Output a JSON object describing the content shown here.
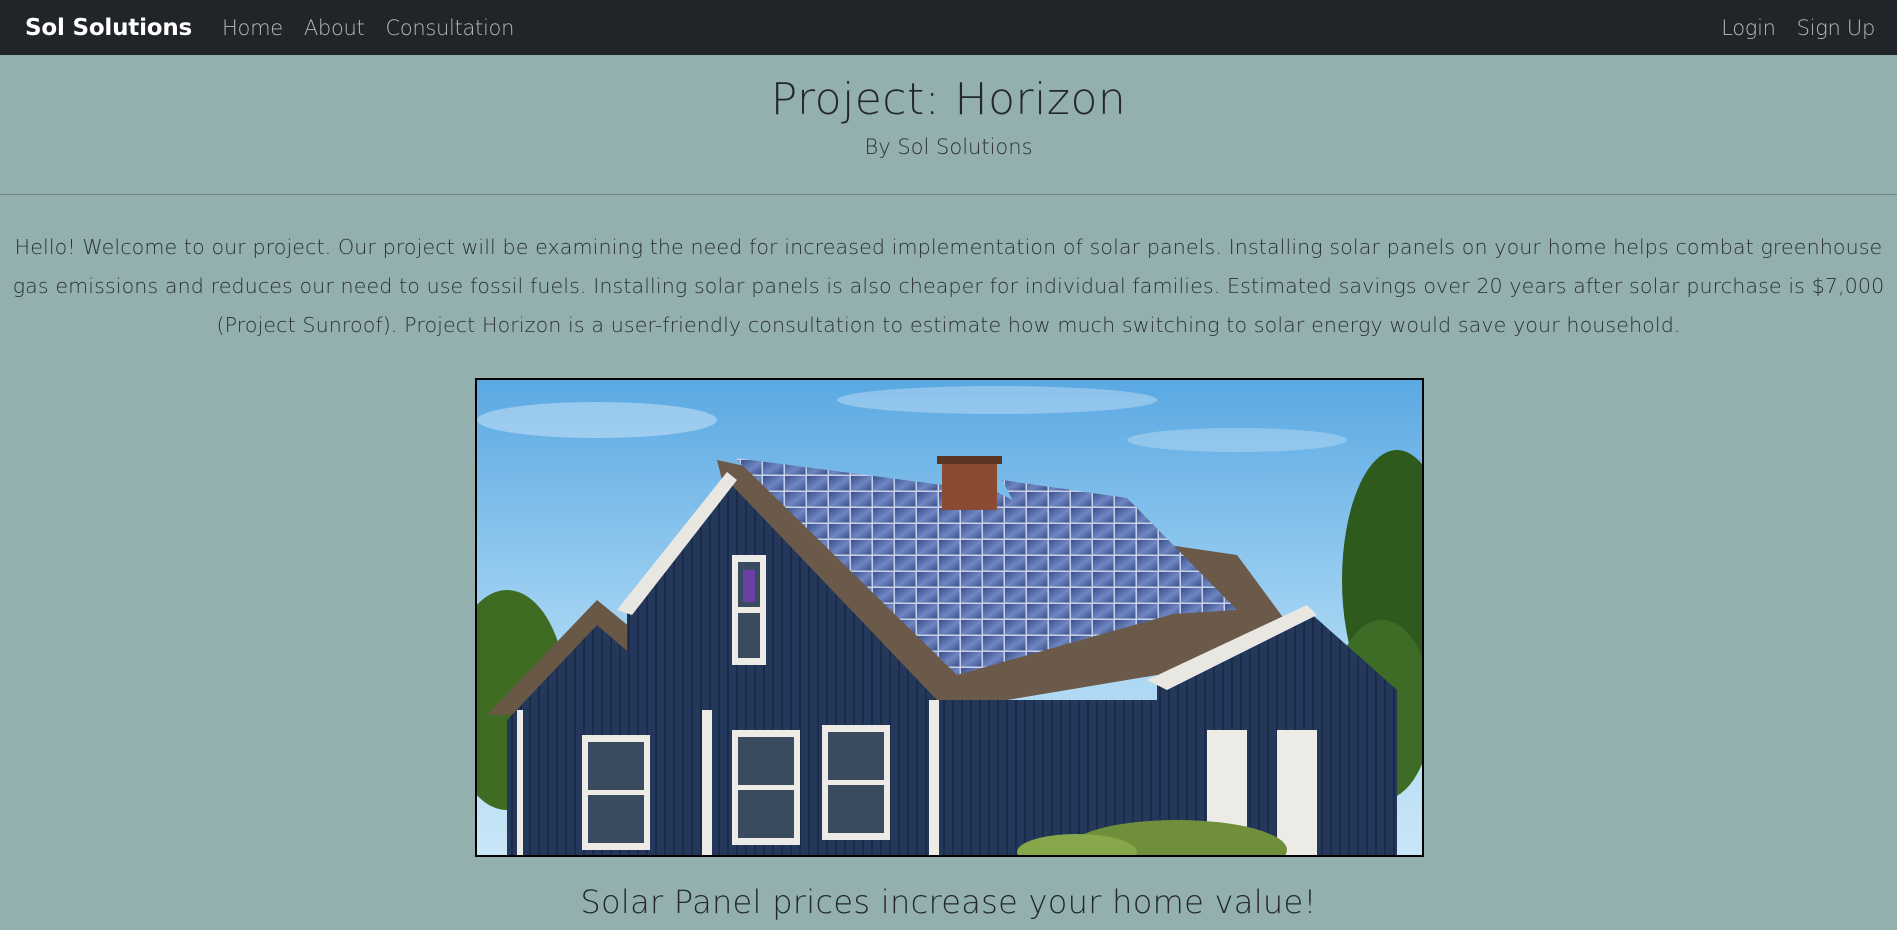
{
  "navbar": {
    "brand": "Sol Solutions",
    "links": [
      "Home",
      "About",
      "Consultation"
    ],
    "right_links": [
      "Login",
      "Sign Up"
    ]
  },
  "header": {
    "title": "Project: Horizon",
    "subtitle": "By Sol Solutions"
  },
  "intro": {
    "text": "Hello! Welcome to our project. Our project will be examining the need for increased implementation of solar panels. Installing solar panels on your home helps combat greenhouse gas emissions and reduces our need to use fossil fuels. Installing solar panels is also cheaper for individual families. Estimated savings over 20 years after solar purchase is $7,000 (Project Sunroof). Project Horizon is a user-friendly consultation to estimate how much switching to solar energy would save your household."
  },
  "hero": {
    "subject": "house-with-solar-panels-image"
  },
  "caption": {
    "text": "Solar Panel prices increase your home value!"
  },
  "colors": {
    "navbar_bg": "#212529",
    "page_bg": "#93afae",
    "brand_text": "#ffffff",
    "nav_link": "#b7b9bb"
  }
}
